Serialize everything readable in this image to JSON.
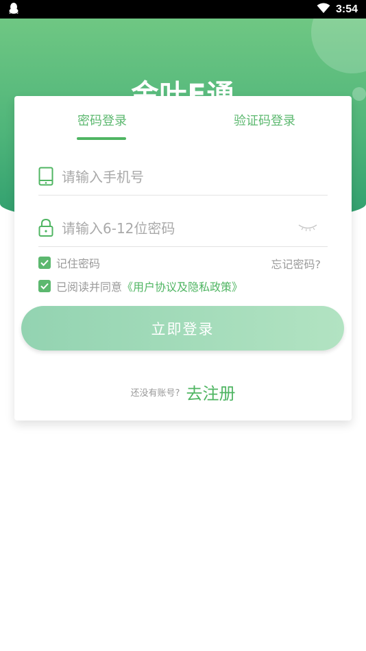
{
  "status_bar": {
    "time": "3:54",
    "left_icon": "qq-penguin-icon",
    "right_icon": "wifi-icon"
  },
  "app": {
    "title": "金叶E通"
  },
  "tabs": [
    {
      "label": "密码登录",
      "active": true
    },
    {
      "label": "验证码登录",
      "active": false
    }
  ],
  "form": {
    "phone": {
      "placeholder": "请输入手机号",
      "value": "",
      "icon": "phone-icon"
    },
    "password": {
      "placeholder": "请输入6-12位密码",
      "value": "",
      "icon": "lock-icon",
      "toggle_icon": "eye-closed-icon"
    },
    "remember": {
      "label": "记住密码",
      "checked": true
    },
    "forgot_label": "忘记密码?",
    "agree": {
      "prefix": "已阅读并同意",
      "link": "《用户协议及隐私政策》",
      "checked": true
    },
    "login_label": "立即登录",
    "register": {
      "prompt": "还没有账号?",
      "link": "去注册"
    }
  },
  "colors": {
    "primary": "#5cb86f",
    "header_top": "#6fc783",
    "header_bottom": "#2f9e6e",
    "button_start": "#93d3b1",
    "button_end": "#b2e3c2"
  }
}
